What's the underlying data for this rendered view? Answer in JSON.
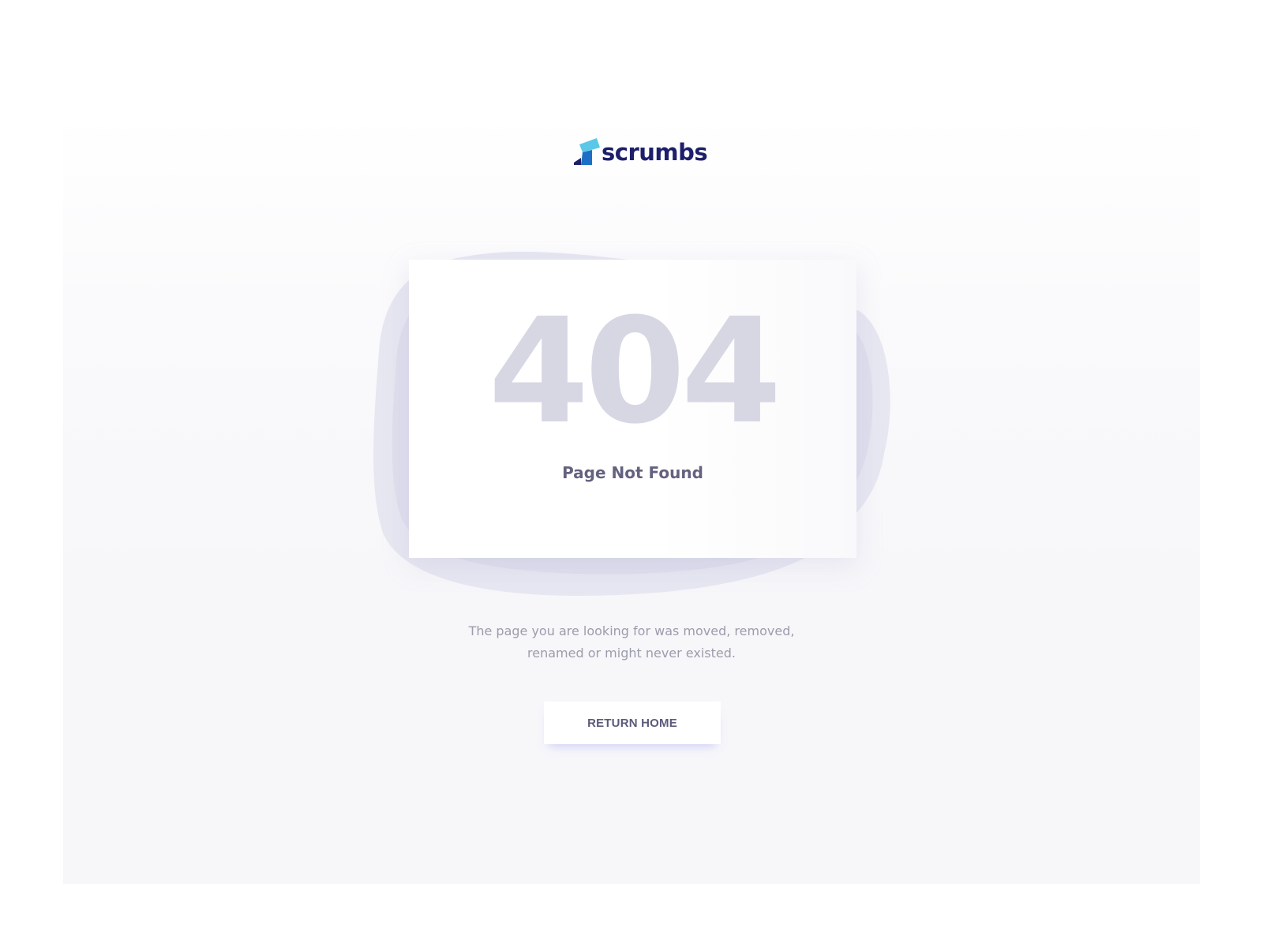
{
  "brand": {
    "name": "scrumbs",
    "logo_icon": "scrumbs-logo-icon",
    "colors": {
      "mark_light": "#5ac8e6",
      "mark_dark": "#1b6fc4",
      "mark_navy": "#1d1f6b",
      "text": "#1d1f6b"
    }
  },
  "error": {
    "code": "404",
    "title": "Page Not Found",
    "message_line1": "The page you are looking for was moved, removed,",
    "message_line2": "renamed or might never existed."
  },
  "actions": {
    "return_home_label": "RETURN HOME"
  },
  "colors": {
    "code": "#d7d7e4",
    "title": "#63627f",
    "message": "#9c9cac",
    "blob": "#dcdcec",
    "button_shadow": "#8a8af0"
  }
}
